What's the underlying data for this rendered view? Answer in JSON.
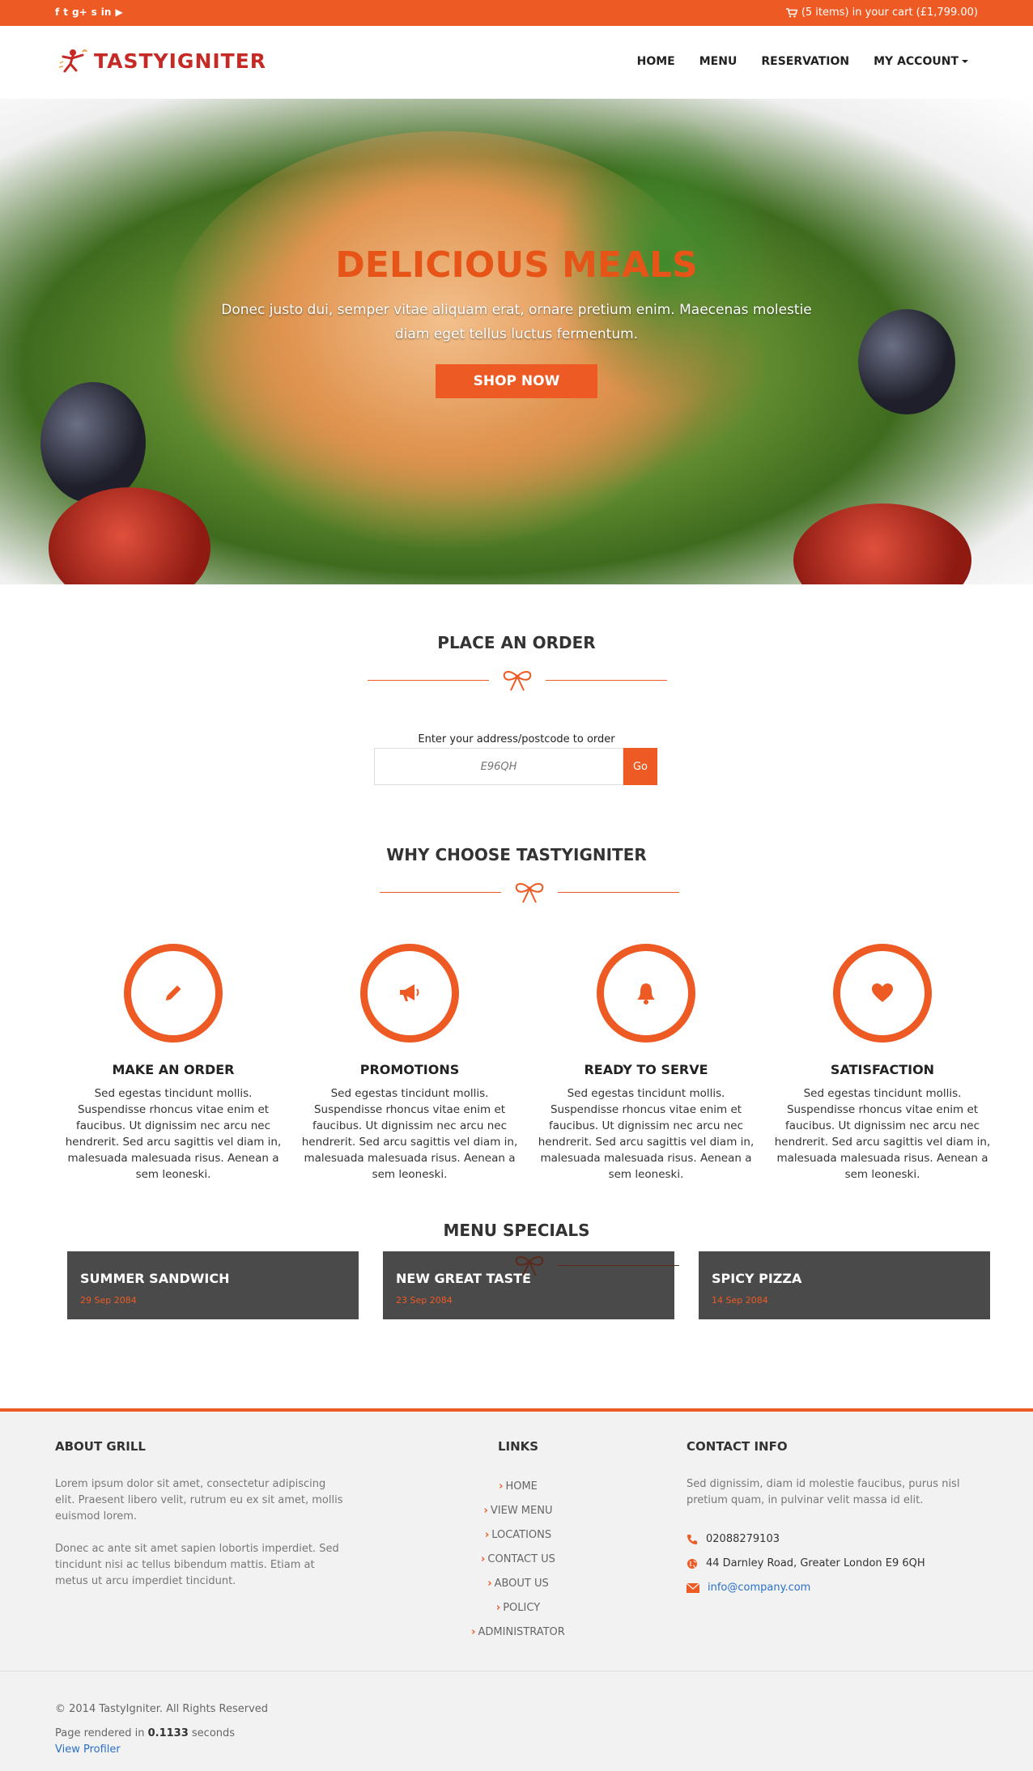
{
  "topbar": {
    "social_icons": [
      "facebook-icon",
      "twitter-icon",
      "google-plus-icon",
      "skype-icon",
      "linkedin-icon",
      "youtube-icon"
    ],
    "social_glyphs": [
      "f",
      "t",
      "g+",
      "s",
      "in",
      "▶"
    ],
    "cart_text": "(5 items) in your cart (£1,799.00)"
  },
  "header": {
    "logo_text": "TASTYIGNITER",
    "nav": [
      {
        "label": "HOME"
      },
      {
        "label": "MENU"
      },
      {
        "label": "RESERVATION"
      },
      {
        "label": "MY ACCOUNT"
      }
    ]
  },
  "hero": {
    "heading": "DELICIOUS MEALS",
    "text": "Donec justo dui, semper vitae aliquam erat, ornare pretium enim. Maecenas molestie diam eget tellus luctus fermentum.",
    "button": "SHOP NOW"
  },
  "order": {
    "title": "PLACE AN ORDER",
    "label": "Enter your address/postcode to order",
    "placeholder": "E96QH",
    "button": "Go"
  },
  "why": {
    "title": "WHY CHOOSE TASTYIGNITER",
    "features": [
      {
        "icon": "pencil-icon",
        "title": "MAKE AN ORDER",
        "text": "Sed egestas tincidunt mollis. Suspendisse rhoncus vitae enim et faucibus. Ut dignissim nec arcu nec hendrerit. Sed arcu sagittis vel diam in, malesuada malesuada risus. Aenean a sem leoneski."
      },
      {
        "icon": "megaphone-icon",
        "title": "PROMOTIONS",
        "text": "Sed egestas tincidunt mollis. Suspendisse rhoncus vitae enim et faucibus. Ut dignissim nec arcu nec hendrerit. Sed arcu sagittis vel diam in, malesuada malesuada risus. Aenean a sem leoneski."
      },
      {
        "icon": "bell-icon",
        "title": "READY TO SERVE",
        "text": "Sed egestas tincidunt mollis. Suspendisse rhoncus vitae enim et faucibus. Ut dignissim nec arcu nec hendrerit. Sed arcu sagittis vel diam in, malesuada malesuada risus. Aenean a sem leoneski."
      },
      {
        "icon": "heart-icon",
        "title": "SATISFACTION",
        "text": "Sed egestas tincidunt mollis. Suspendisse rhoncus vitae enim et faucibus. Ut dignissim nec arcu nec hendrerit. Sed arcu sagittis vel diam in, malesuada malesuada risus. Aenean a sem leoneski."
      }
    ]
  },
  "specials": {
    "title": "MENU SPECIALS",
    "items": [
      {
        "name": "SUMMER SANDWICH",
        "date": "29 Sep 2084"
      },
      {
        "name": "NEW GREAT TASTE",
        "date": "23 Sep 2084"
      },
      {
        "name": "SPICY PIZZA",
        "date": "14 Sep 2084"
      }
    ]
  },
  "footer": {
    "about_title": "ABOUT GRILL",
    "about_p1": "Lorem ipsum dolor sit amet, consectetur adipiscing elit. Praesent libero velit, rutrum eu ex sit amet, mollis euismod lorem.",
    "about_p2": "Donec ac ante sit amet sapien lobortis imperdiet. Sed tincidunt nisi ac tellus bibendum mattis. Etiam at metus ut arcu imperdiet tincidunt.",
    "links_title": "LINKS",
    "links": [
      "HOME",
      "VIEW MENU",
      "LOCATIONS",
      "CONTACT US",
      "ABOUT US",
      "POLICY",
      "ADMINISTRATOR"
    ],
    "contact_title": "CONTACT INFO",
    "contact_text": "Sed dignissim, diam id molestie faucibus, purus nisl pretium quam, in pulvinar velit massa id elit.",
    "phone": "02088279103",
    "address": "44 Darnley Road, Greater London E9 6QH",
    "email": "info@company.com",
    "copyright": "© 2014 TastyIgniter. All Rights Reserved",
    "rendered_prefix": "Page rendered in",
    "rendered_value": "0.1133",
    "rendered_suffix": "seconds",
    "profiler": "View Profiler"
  },
  "colors": {
    "accent": "#ee5a23",
    "logo": "#c62a26",
    "special_bg": "#4a4a4a",
    "link": "#2a6fc9"
  }
}
